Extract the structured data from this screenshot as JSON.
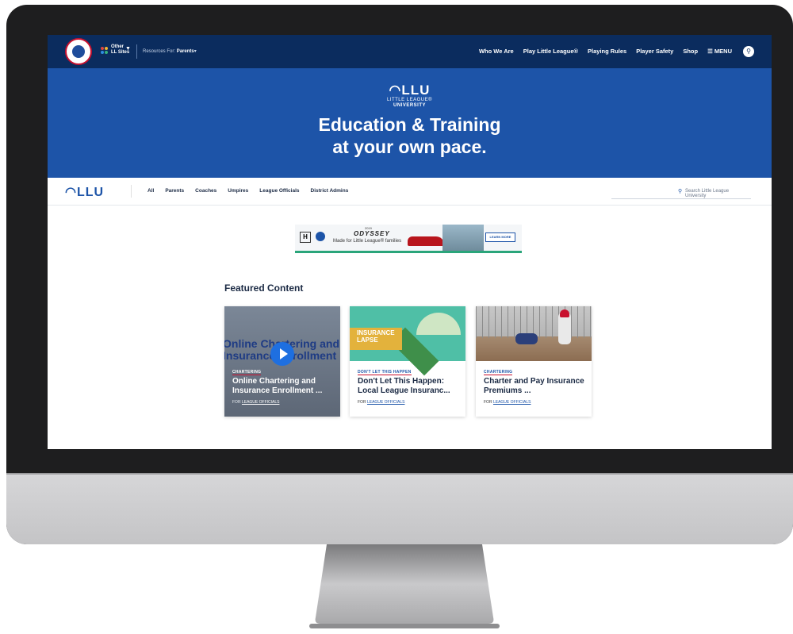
{
  "topnav": {
    "other_sites_line1": "Other",
    "other_sites_line2": "LL Sites",
    "resources_label": "Resources For:",
    "resources_value": "Parents",
    "links": [
      "Who We Are",
      "Play Little League®",
      "Playing Rules",
      "Player Safety",
      "Shop"
    ],
    "menu_label": "MENU"
  },
  "hero": {
    "logo": "LLU",
    "logo_line1": "LITTLE LEAGUE®",
    "logo_line2": "UNIVERSITY",
    "headline_line1": "Education & Training",
    "headline_line2": "at your own pace."
  },
  "subnav": {
    "logo": "LLU",
    "categories": [
      "All",
      "Parents",
      "Coaches",
      "Umpires",
      "League Officials",
      "District Admins"
    ],
    "search_placeholder": "Search Little League University"
  },
  "ad": {
    "year": "2019",
    "brand": "ODYSSEY",
    "tagline": "Made for Little League® families",
    "cta": "LEARN MORE"
  },
  "featured": {
    "title": "Featured Content",
    "cards": [
      {
        "overlay_text_line1": "Online Chartering and",
        "overlay_text_line2": "Insurance Enrollment",
        "category": "CHARTERING",
        "title": "Online Chartering and Insurance Enrollment ...",
        "for_label": "FOR",
        "audience": "LEAGUE OFFICIALS"
      },
      {
        "thumb_text_line1": "INSURANCE",
        "thumb_text_line2": "LAPSE",
        "category": "DON'T LET THIS HAPPEN",
        "title": "Don't Let This Happen: Local League Insuranc...",
        "for_label": "FOR",
        "audience": "LEAGUE OFFICIALS"
      },
      {
        "category": "CHARTERING",
        "title": "Charter and Pay Insurance Premiums ...",
        "for_label": "FOR",
        "audience": "LEAGUE OFFICIALS"
      }
    ]
  },
  "colors": {
    "navy": "#0b2c5e",
    "brand_blue": "#1d54a8",
    "accent_red": "#c8102e",
    "bezel": "#1e1e1f"
  }
}
